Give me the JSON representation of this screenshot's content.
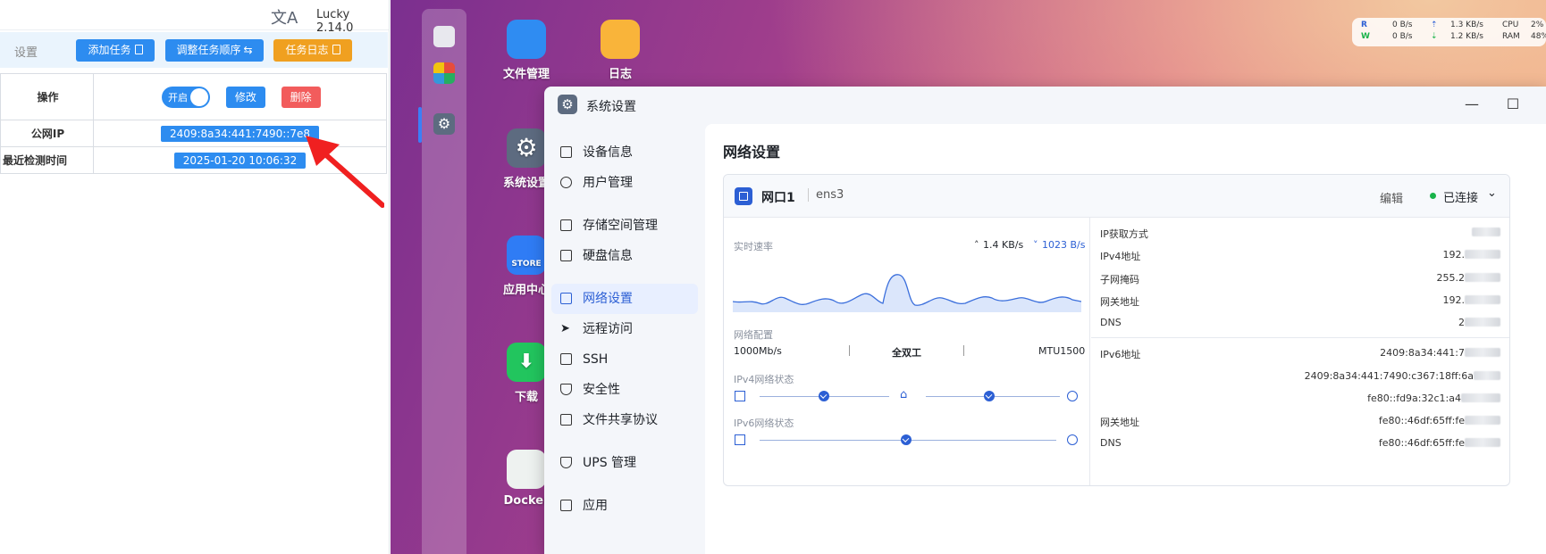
{
  "lucky": {
    "version": "Lucky 2.14.0",
    "translate_glyph": "文A",
    "toolbar": {
      "settings_label": "设置",
      "add_task": "添加任务",
      "reorder": "调整任务顺序",
      "task_log": "任务日志"
    },
    "rows": {
      "operation_key": "操作",
      "toggle_label": "开启",
      "edit": "修改",
      "delete": "删除",
      "public_ip_key": "公网IP",
      "public_ip_value": "2409:8a34:441:7490::7e8",
      "last_check_key": "最近检测时间",
      "last_check_value": "2025-01-20 10:06:32"
    }
  },
  "desktop": {
    "apps": [
      {
        "label": "文件管理"
      },
      {
        "label": "日志"
      },
      {
        "label": "系统设置"
      },
      {
        "label": "应用中心"
      },
      {
        "label": "下载"
      },
      {
        "label": "Docker"
      }
    ],
    "stats": {
      "r_label": "R",
      "w_label": "W",
      "r_rate": "0 B/s",
      "w_rate": "0 B/s",
      "up_rate": "1.3 KB/s",
      "down_rate": "1.2 KB/s",
      "cpu_label": "CPU",
      "cpu_val": "2%",
      "ram_label": "RAM",
      "ram_val": "48%"
    }
  },
  "window": {
    "title": "系统设置",
    "nav": [
      {
        "label": "设备信息"
      },
      {
        "label": "用户管理"
      },
      {
        "label": "存储空间管理"
      },
      {
        "label": "硬盘信息"
      },
      {
        "label": "网络设置",
        "active": true
      },
      {
        "label": "远程访问"
      },
      {
        "label": "SSH"
      },
      {
        "label": "安全性"
      },
      {
        "label": "文件共享协议"
      },
      {
        "label": "UPS 管理"
      },
      {
        "label": "应用"
      }
    ],
    "main": {
      "heading": "网络设置",
      "port": {
        "name": "网口1",
        "iface": "ens3",
        "edit": "编辑",
        "status": "已连接"
      },
      "speed": {
        "label": "实时速率",
        "up": "1.4 KB/s",
        "down": "1023 B/s"
      },
      "config": {
        "label": "网络配置",
        "speed": "1000Mb/s",
        "duplex": "全双工",
        "mtu": "MTU1500"
      },
      "ipv4_status_label": "IPv4网络状态",
      "ipv6_status_label": "IPv6网络状态",
      "info": {
        "ip_method_key": "IP获取方式",
        "ipv4_key": "IPv4地址",
        "ipv4_val": "192.",
        "mask_key": "子网掩码",
        "mask_val": "255.2",
        "gw_key": "网关地址",
        "gw_val": "192.",
        "dns_key": "DNS",
        "dns_val": "2",
        "ipv6_key": "IPv6地址",
        "ipv6_val1": "2409:8a34:441:7",
        "ipv6_val2": "2409:8a34:441:7490:c367:18ff:6a",
        "ipv6_val3": "fe80::fd9a:32c1:a4",
        "gw6_key": "网关地址",
        "gw6_val": "fe80::46df:65ff:fe",
        "dns6_key": "DNS",
        "dns6_val": "fe80::46df:65ff:fe"
      }
    }
  },
  "colors": {
    "accent": "#2d8cf0",
    "orange": "#f0a020",
    "red": "#f25c5c",
    "nas_blue": "#2c5fd4",
    "connected": "#19b34a"
  }
}
